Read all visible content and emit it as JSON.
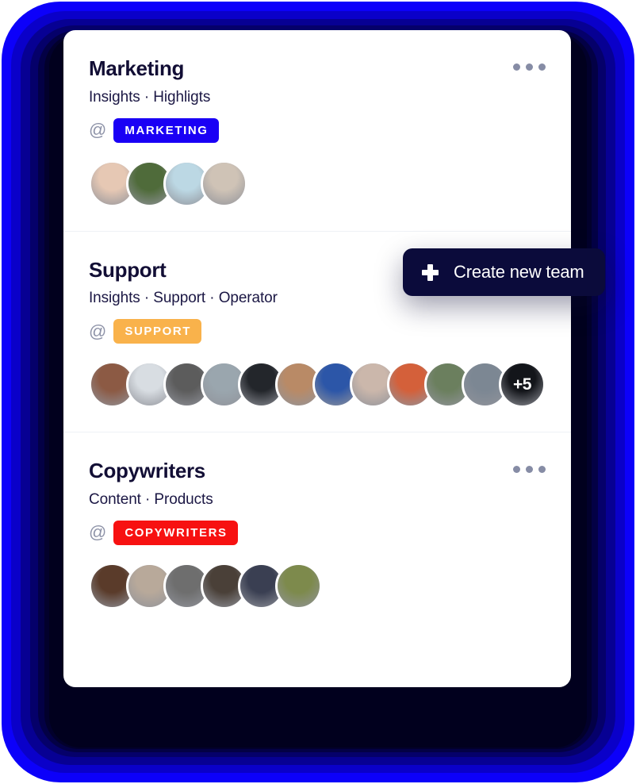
{
  "teams": [
    {
      "name": "Marketing",
      "subtitle": "Insights · Highligts",
      "at_symbol": "@",
      "handle": "MARKETING",
      "badge_color": "#1a00f5",
      "menu_visible": true,
      "members": [
        {
          "tone": "#e6c8b4"
        },
        {
          "tone": "#4f6b3a"
        },
        {
          "tone": "#bcd8e4"
        },
        {
          "tone": "#cfc3b6"
        }
      ],
      "overflow_label": null
    },
    {
      "name": "Support",
      "subtitle": "Insights · Support · Operator",
      "at_symbol": "@",
      "handle": "SUPPORT",
      "badge_color": "#f9b24b",
      "menu_visible": false,
      "members": [
        {
          "tone": "#8c5a44"
        },
        {
          "tone": "#d8dde2"
        },
        {
          "tone": "#5c5c5c"
        },
        {
          "tone": "#9aa6ae"
        },
        {
          "tone": "#23262b"
        },
        {
          "tone": "#b98a66"
        },
        {
          "tone": "#2c56a8"
        },
        {
          "tone": "#cbb7ab"
        },
        {
          "tone": "#d4603a"
        },
        {
          "tone": "#6b7f5e"
        },
        {
          "tone": "#7c8793"
        },
        {
          "tone": "#2b2f3a"
        }
      ],
      "overflow_label": "+5"
    },
    {
      "name": "Copywriters",
      "subtitle": "Content · Products",
      "at_symbol": "@",
      "handle": "COPYWRITERS",
      "badge_color": "#f71111",
      "menu_visible": true,
      "members": [
        {
          "tone": "#5a3b2a"
        },
        {
          "tone": "#b8a99a"
        },
        {
          "tone": "#6e6e6e"
        },
        {
          "tone": "#4a4038"
        },
        {
          "tone": "#3a3f52"
        },
        {
          "tone": "#7d8a4c"
        }
      ],
      "overflow_label": null
    }
  ],
  "create_button": {
    "label": "Create new team",
    "icon": "plus-icon",
    "background": "#0b0b3b"
  },
  "menu_icon": "ellipsis-icon"
}
